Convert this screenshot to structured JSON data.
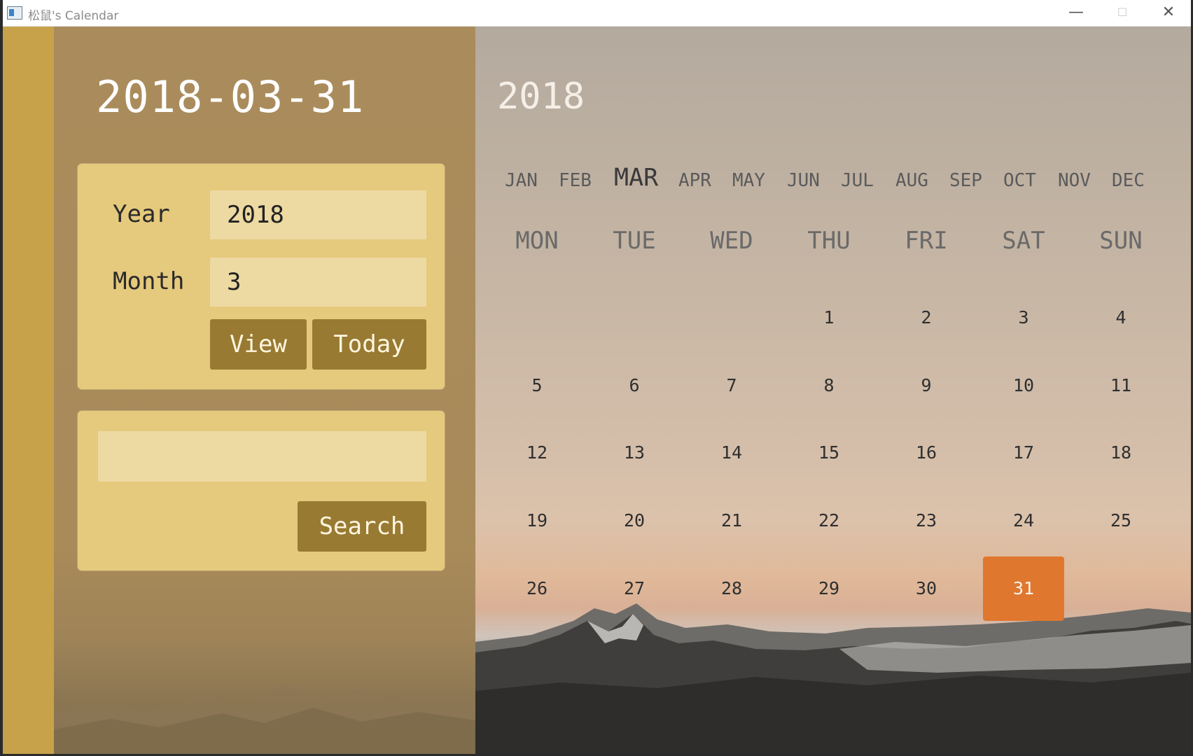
{
  "window": {
    "title": "松鼠's Calendar",
    "minimize": "—",
    "maximize": "☐",
    "close": "✕"
  },
  "selected_date": "2018-03-31",
  "form": {
    "year_label": "Year",
    "year_value": "2018",
    "month_label": "Month",
    "month_value": "3",
    "view_button": "View",
    "today_button": "Today",
    "search_value": "",
    "search_button": "Search"
  },
  "calendar": {
    "year": "2018",
    "months": [
      "JAN",
      "FEB",
      "MAR",
      "APR",
      "MAY",
      "JUN",
      "JUL",
      "AUG",
      "SEP",
      "OCT",
      "NOV",
      "DEC"
    ],
    "active_month": "MAR",
    "weekdays": [
      "MON",
      "TUE",
      "WED",
      "THU",
      "FRI",
      "SAT",
      "SUN"
    ],
    "weeks": [
      [
        "",
        "",
        "",
        "1",
        "2",
        "3",
        "4"
      ],
      [
        "5",
        "6",
        "7",
        "8",
        "9",
        "10",
        "11"
      ],
      [
        "12",
        "13",
        "14",
        "15",
        "16",
        "17",
        "18"
      ],
      [
        "19",
        "20",
        "21",
        "22",
        "23",
        "24",
        "25"
      ],
      [
        "26",
        "27",
        "28",
        "29",
        "30",
        "31",
        ""
      ]
    ],
    "selected_day": "31"
  },
  "colors": {
    "accent": "#e0772f",
    "button": "#987a32",
    "card": "#e5c97d",
    "stripe": "#c7a24a"
  }
}
